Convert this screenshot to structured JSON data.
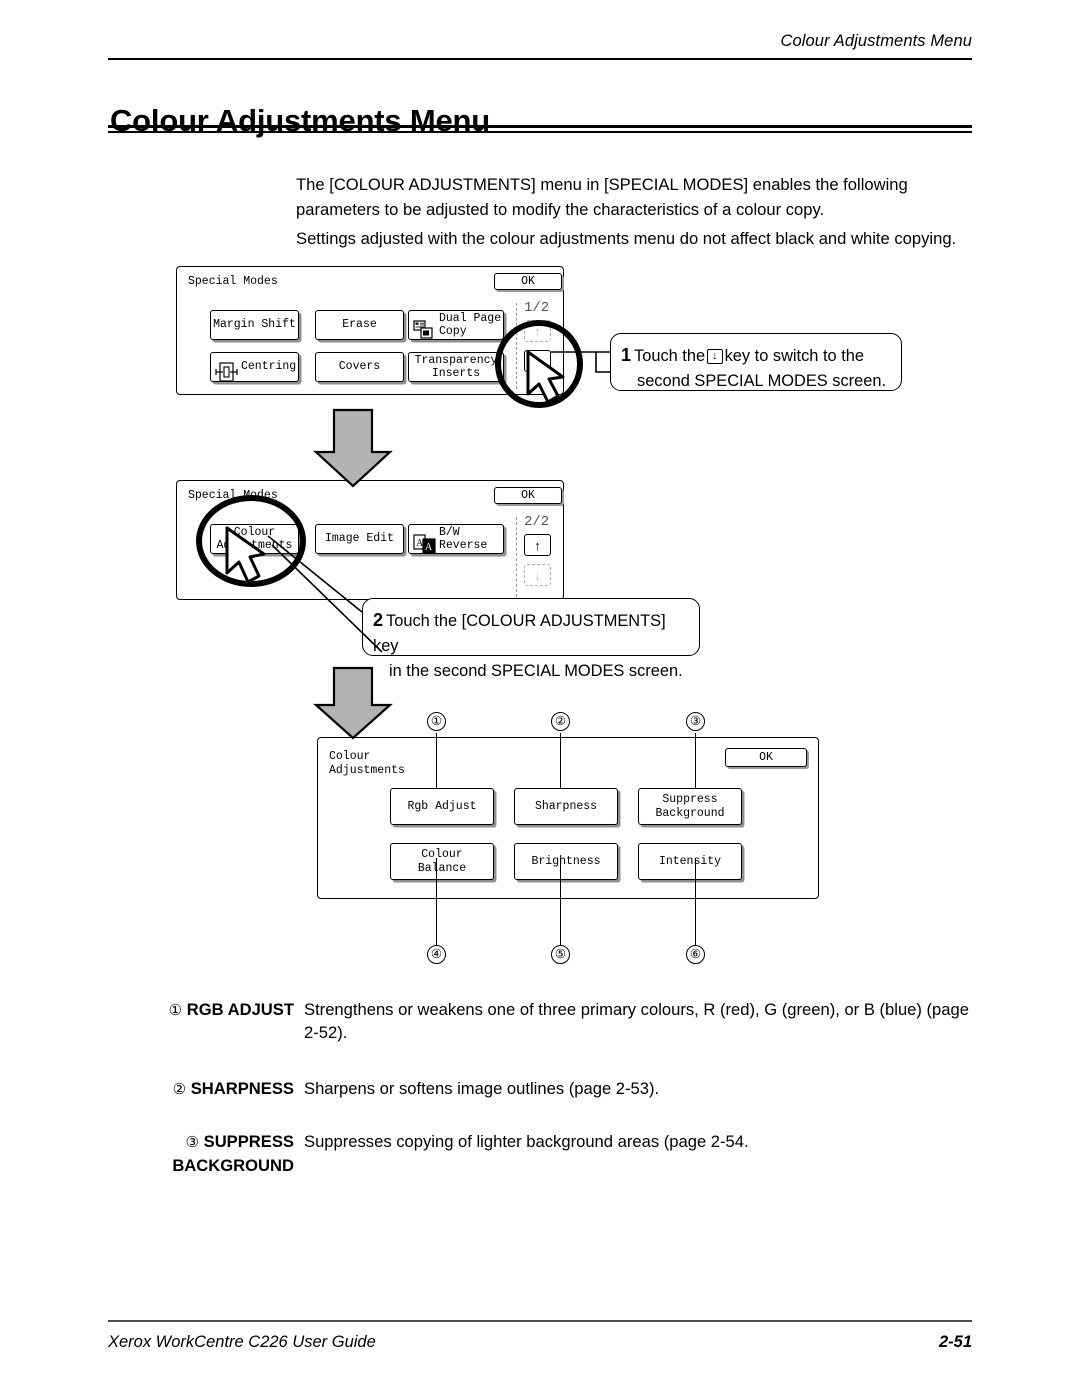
{
  "running_head": "Colour Adjustments Menu",
  "page_title": "Colour Adjustments Menu",
  "intro": {
    "p1": "The [COLOUR ADJUSTMENTS] menu in [SPECIAL MODES] enables the following parameters to be adjusted to modify the characteristics of a colour copy.",
    "p2": "Settings adjusted with the colour adjustments menu do not affect black and white copying."
  },
  "panel1": {
    "title": "Special Modes",
    "ok_label": "OK",
    "page_count": "1/2",
    "keys": [
      {
        "label": "Margin Shift",
        "icon": ""
      },
      {
        "label": "Erase",
        "icon": ""
      },
      {
        "label": "Dual Page\nCopy",
        "icon": "dual-page-copy-icon"
      },
      {
        "label": "Centring",
        "icon": "centring-icon"
      },
      {
        "label": "Covers",
        "icon": ""
      },
      {
        "label": "Transparency\nInserts",
        "icon": ""
      }
    ],
    "up_key": "↑",
    "down_key": "↓"
  },
  "panel2": {
    "title": "Special Modes",
    "ok_label": "OK",
    "page_count": "2/2",
    "keys": [
      {
        "label": "Colour\nAdjustments",
        "icon": ""
      },
      {
        "label": "Image Edit",
        "icon": ""
      },
      {
        "label": "B/W\nReverse",
        "icon": "bw-reverse-icon"
      }
    ],
    "up_key": "↑",
    "down_key": "↓"
  },
  "panel3": {
    "title": "Colour\nAdjustments",
    "ok_label": "OK",
    "keys": [
      {
        "label": "Rgb Adjust"
      },
      {
        "label": "Sharpness"
      },
      {
        "label": "Suppress\nBackground"
      },
      {
        "label": "Colour\nBalance"
      },
      {
        "label": "Brightness"
      },
      {
        "label": "Intensity"
      }
    ],
    "markers_top": [
      "①",
      "②",
      "③"
    ],
    "markers_bottom": [
      "④",
      "⑤",
      "⑥"
    ]
  },
  "callouts": [
    {
      "number": "1",
      "line1_a": "Touch the",
      "key_glyph": "↓",
      "line1_b": "key to switch to the",
      "line2": "second SPECIAL MODES screen."
    },
    {
      "number": "2",
      "line1_a": "Touch the [COLOUR ADJUSTMENTS] key",
      "key_glyph": "",
      "line1_b": "",
      "line2": "in the second SPECIAL MODES screen."
    }
  ],
  "descriptions": [
    {
      "marker": "①",
      "term": "RGB ADJUST",
      "term2": "",
      "definition": "Strengthens or weakens one of three primary colours, R (red), G (green), or B (blue) (page 2-52)."
    },
    {
      "marker": "②",
      "term": "SHARPNESS",
      "term2": "",
      "definition": "Sharpens or softens image outlines (page 2-53)."
    },
    {
      "marker": "③",
      "term": "SUPPRESS",
      "term2": "BACKGROUND",
      "definition": "Suppresses copying of lighter background areas (page 2-54."
    }
  ],
  "footer": {
    "left": "Xerox WorkCentre C226 User Guide",
    "right": "2-51"
  },
  "colors": {
    "ink": "#000000",
    "grey_arrow_fill": "#b3b3b3",
    "key_shadow": "#8f8f8f",
    "rule_grey": "#4d4d4d"
  }
}
